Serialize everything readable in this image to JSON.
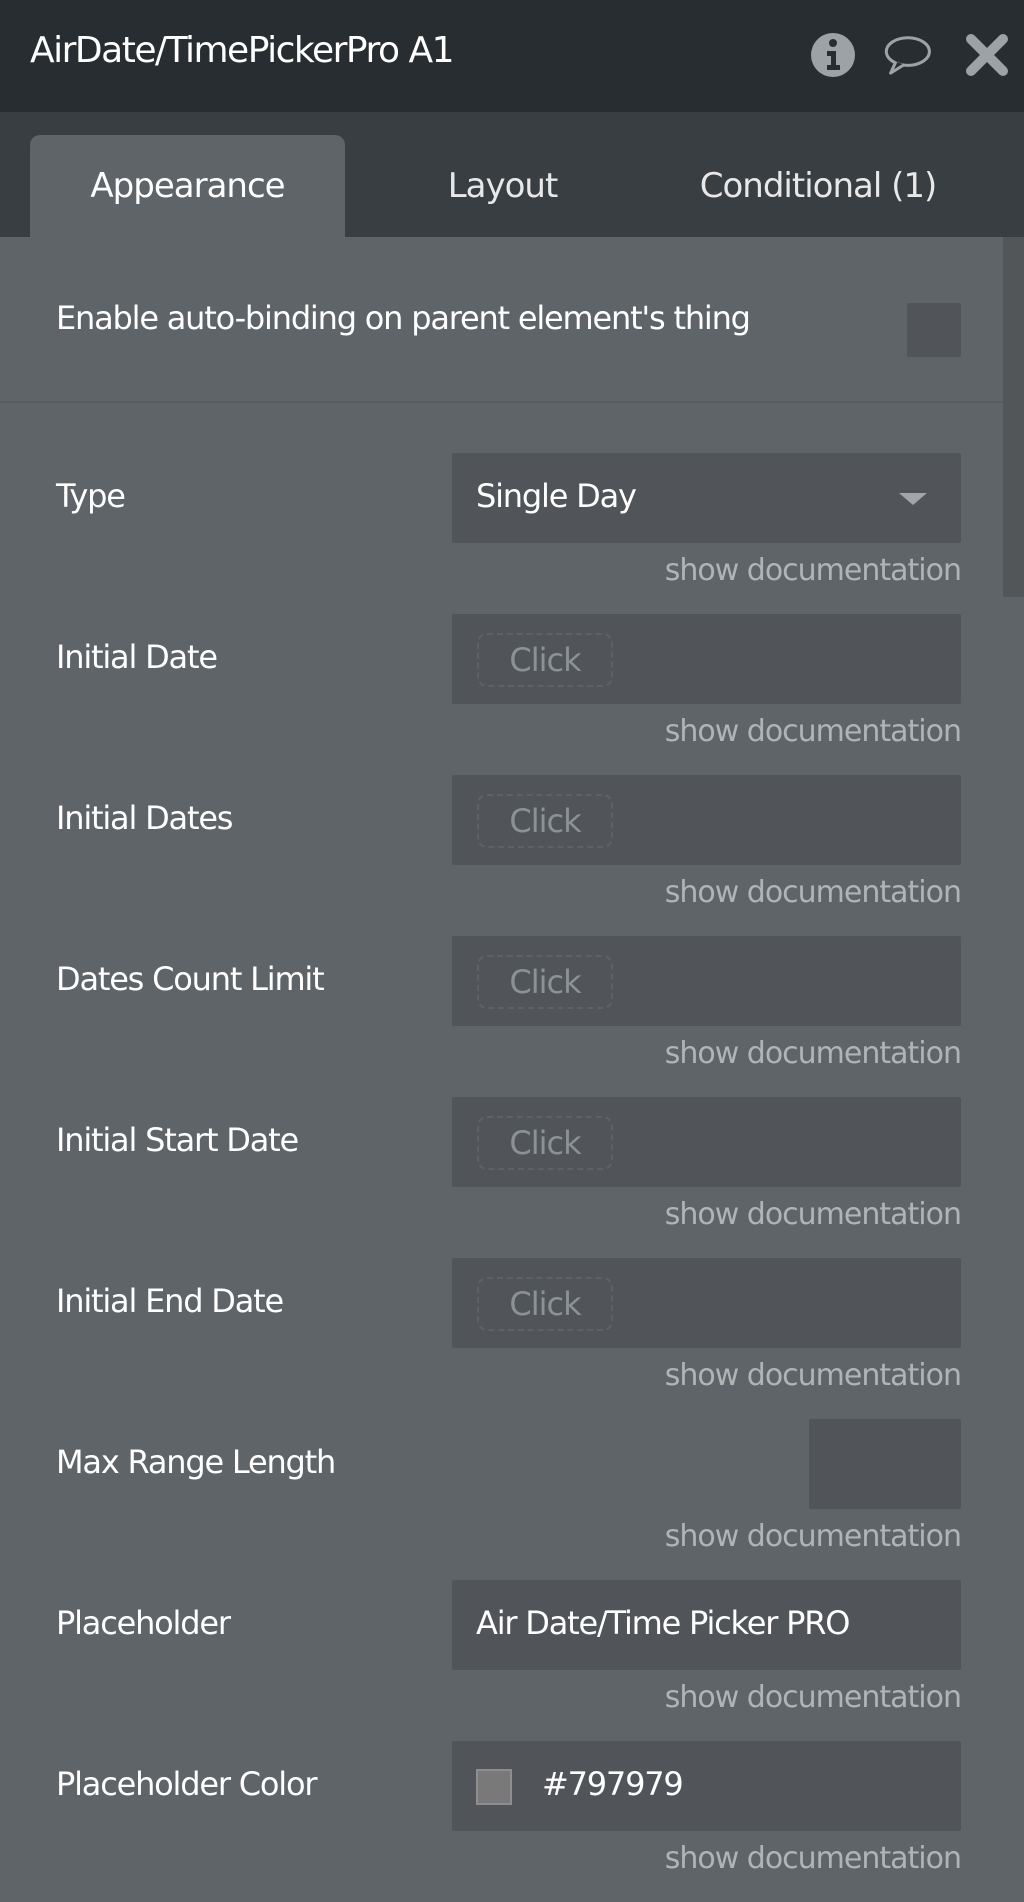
{
  "header": {
    "title": "AirDate/TimePickerPro A1",
    "icons": [
      "info-icon",
      "comment-icon",
      "close-icon"
    ]
  },
  "tabs": [
    {
      "label": "Appearance",
      "active": true
    },
    {
      "label": "Layout",
      "active": false
    },
    {
      "label": "Conditional (1)",
      "active": false
    }
  ],
  "autobinding": {
    "label": "Enable auto-binding on parent element's thing",
    "checked": false
  },
  "doc_link": "show documentation",
  "fields": [
    {
      "label": "Type",
      "kind": "dropdown",
      "value": "Single Day"
    },
    {
      "label": "Initial Date",
      "kind": "dynamic",
      "value": "Click"
    },
    {
      "label": "Initial Dates",
      "kind": "dynamic",
      "value": "Click"
    },
    {
      "label": "Dates Count Limit",
      "kind": "dynamic",
      "value": "Click"
    },
    {
      "label": "Initial Start Date",
      "kind": "dynamic",
      "value": "Click"
    },
    {
      "label": "Initial End Date",
      "kind": "dynamic",
      "value": "Click"
    },
    {
      "label": "Max Range Length",
      "kind": "number",
      "value": ""
    },
    {
      "label": "Placeholder",
      "kind": "text",
      "value": "Air Date/Time Picker PRO"
    },
    {
      "label": "Placeholder Color",
      "kind": "color",
      "value": "#797979",
      "swatch": "#797979"
    }
  ],
  "colors": {
    "header_bg": "#272d30",
    "tabbar_bg": "#393e42",
    "panel_bg": "#5f6468",
    "field_bg": "#515559",
    "doc_link": "#b1b3b5"
  }
}
